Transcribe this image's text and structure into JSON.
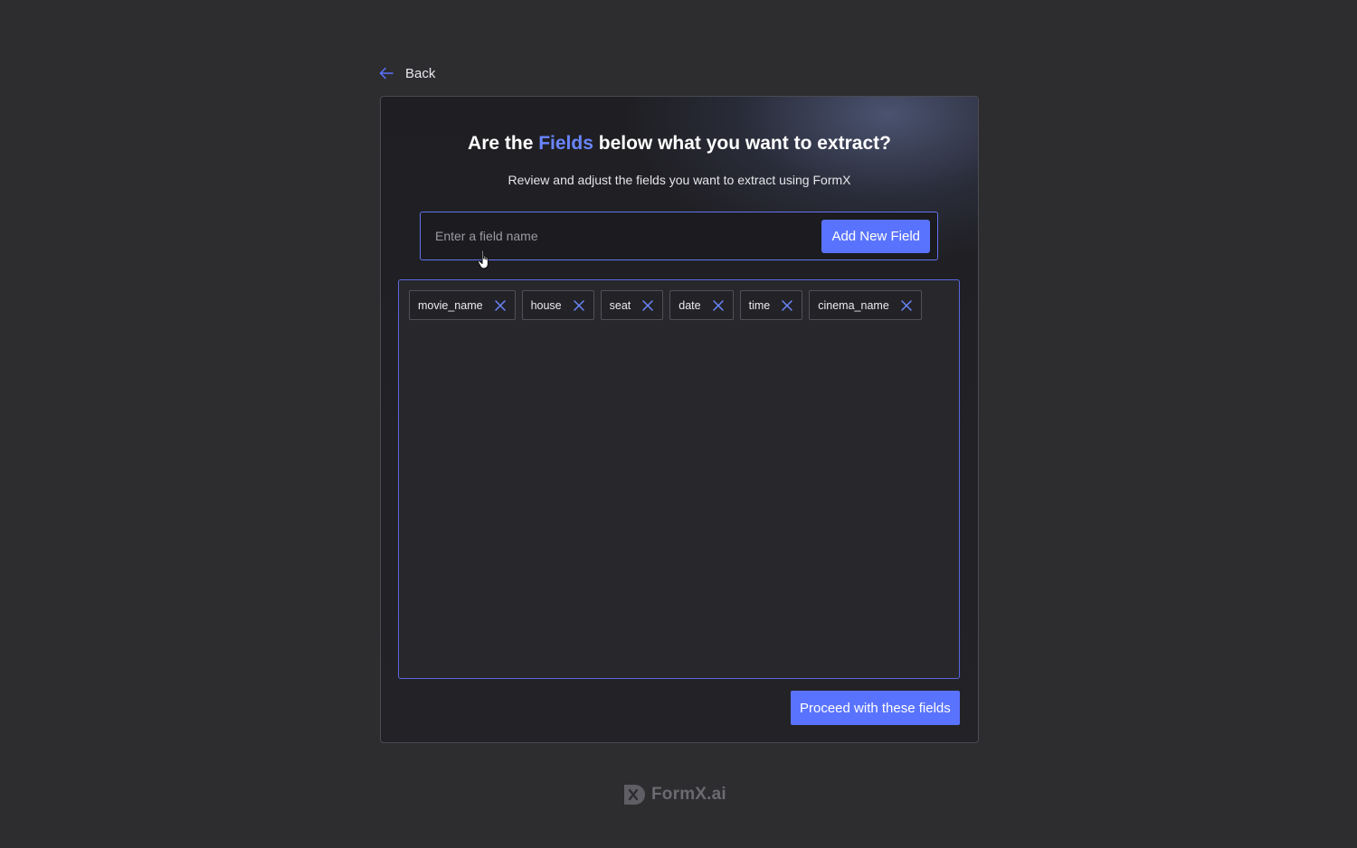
{
  "back": {
    "label": "Back",
    "icon": "arrow-left-icon"
  },
  "card": {
    "title_prefix": "Are the ",
    "title_accent": "Fields",
    "title_suffix": " below what you want to extract?",
    "subtitle": "Review and adjust the fields you want to extract using FormX",
    "input": {
      "placeholder": "Enter a field name",
      "value": ""
    },
    "add_button": "Add New Field",
    "fields": [
      {
        "label": "movie_name"
      },
      {
        "label": "house"
      },
      {
        "label": "seat"
      },
      {
        "label": "date"
      },
      {
        "label": "time"
      },
      {
        "label": "cinema_name"
      }
    ],
    "proceed_button": "Proceed with these fields"
  },
  "footer": {
    "logo_text": "FormX.ai"
  },
  "colors": {
    "accent": "#5a73ff",
    "title_accent": "#6a86ff",
    "background": "#2d2d30"
  }
}
